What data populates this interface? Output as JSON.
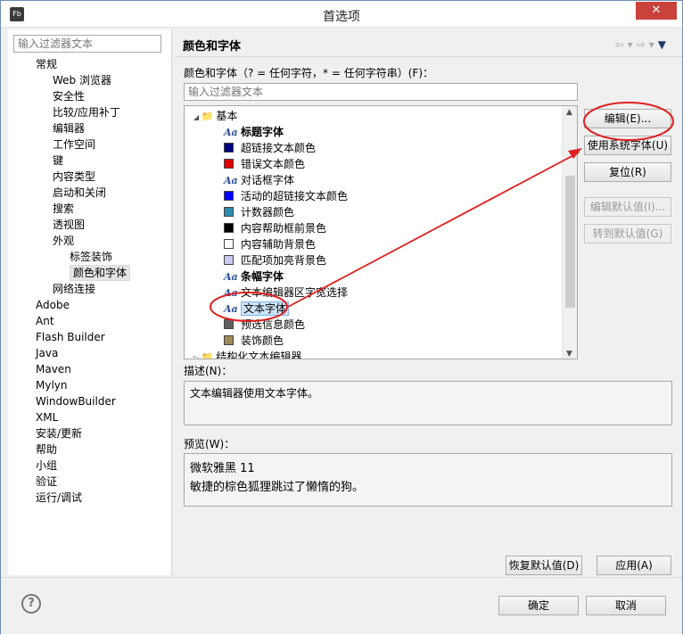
{
  "window": {
    "title": "首选项",
    "close": "✕",
    "app_icon": "Fb"
  },
  "left": {
    "filter_placeholder": "输入过滤器文本",
    "tree": [
      {
        "label": "常规",
        "level": 1
      },
      {
        "label": "Web 浏览器",
        "level": 2
      },
      {
        "label": "安全性",
        "level": 2
      },
      {
        "label": "比较/应用补丁",
        "level": 2
      },
      {
        "label": "编辑器",
        "level": 2
      },
      {
        "label": "工作空间",
        "level": 2
      },
      {
        "label": "键",
        "level": 2
      },
      {
        "label": "内容类型",
        "level": 2
      },
      {
        "label": "启动和关闭",
        "level": 2
      },
      {
        "label": "搜索",
        "level": 2
      },
      {
        "label": "透视图",
        "level": 2
      },
      {
        "label": "外观",
        "level": 2
      },
      {
        "label": "标签装饰",
        "level": 3
      },
      {
        "label": "颜色和字体",
        "level": 3,
        "selected": true
      },
      {
        "label": "网络连接",
        "level": 2
      },
      {
        "label": "Adobe",
        "level": 0
      },
      {
        "label": "Ant",
        "level": 0
      },
      {
        "label": "Flash Builder",
        "level": 0
      },
      {
        "label": "Java",
        "level": 0
      },
      {
        "label": "Maven",
        "level": 0
      },
      {
        "label": "Mylyn",
        "level": 0
      },
      {
        "label": "WindowBuilder",
        "level": 0
      },
      {
        "label": "XML",
        "level": 0
      },
      {
        "label": "安装/更新",
        "level": 0
      },
      {
        "label": "帮助",
        "level": 0
      },
      {
        "label": "小组",
        "level": 0
      },
      {
        "label": "验证",
        "level": 0
      },
      {
        "label": "运行/调试",
        "level": 0
      }
    ]
  },
  "right": {
    "heading": "颜色和字体",
    "nav": {
      "back": "⇦",
      "forward": "⇨",
      "dropdown": "▾",
      "menu": "▼"
    },
    "filter_label": "颜色和字体（? = 任何字符，* = 任何字符串）(F)：",
    "filter_placeholder": "输入过滤器文本",
    "list": [
      {
        "label": "基本",
        "type": "group"
      },
      {
        "label": "标题字体",
        "type": "font",
        "bold": true
      },
      {
        "label": "超链接文本颜色",
        "type": "color",
        "color": "#00007f"
      },
      {
        "label": "错误文本颜色",
        "type": "color",
        "color": "#e00000"
      },
      {
        "label": "对话框字体",
        "type": "font"
      },
      {
        "label": "活动的超链接文本颜色",
        "type": "color",
        "color": "#0000ff"
      },
      {
        "label": "计数器颜色",
        "type": "color",
        "color": "#2a8cae"
      },
      {
        "label": "内容帮助框前景色",
        "type": "color",
        "color": "#000000"
      },
      {
        "label": "内容辅助背景色",
        "type": "color",
        "color": "#ffffff"
      },
      {
        "label": "匹配项加亮背景色",
        "type": "color",
        "color": "#c8c8f0"
      },
      {
        "label": "条幅字体",
        "type": "font",
        "bold": true
      },
      {
        "label": "文本编辑器区字宽选择",
        "type": "font"
      },
      {
        "label": "文本字体",
        "type": "font",
        "selected": true
      },
      {
        "label": "预选信息颜色",
        "type": "color",
        "color": "#606060"
      },
      {
        "label": "装饰颜色",
        "type": "color",
        "color": "#9e8a5a"
      },
      {
        "label": "结构化文本编辑器",
        "type": "group2"
      }
    ],
    "buttons": {
      "edit": "编辑(E)...",
      "use_system_font": "使用系统字体(U)",
      "reset": "复位(R)",
      "edit_default": "编辑默认值(I)...",
      "goto_default": "转到默认值(G)"
    },
    "description_label": "描述(N)：",
    "description": "文本编辑器使用文本字体。",
    "preview_label": "预览(W)：",
    "preview_line1": "微软雅黑 11",
    "preview_line2": "敏捷的棕色狐狸跳过了懒惰的狗。",
    "restore_defaults": "恢复默认值(D)",
    "apply": "应用(A)"
  },
  "bottom": {
    "ok": "确定",
    "cancel": "取消",
    "help_icon": "?"
  },
  "annotation": {
    "color": "#e02020"
  }
}
